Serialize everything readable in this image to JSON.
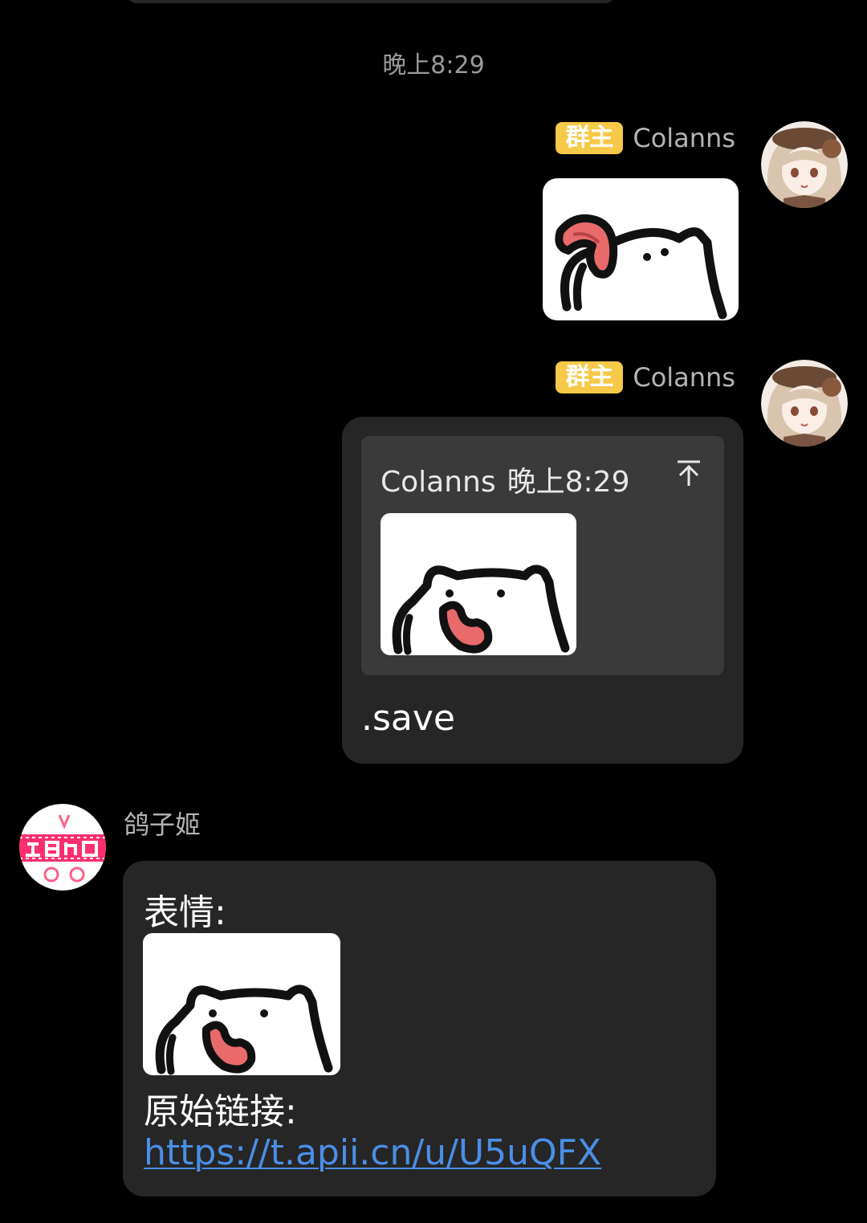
{
  "chat": {
    "timestamp": "晚上8:29",
    "messages": [
      {
        "sender": "Colanns",
        "badge": "群主",
        "side": "right",
        "type": "sticker",
        "sticker_icon": "cat-tongue-sticker"
      },
      {
        "sender": "Colanns",
        "badge": "群主",
        "side": "right",
        "type": "reply",
        "quote": {
          "author": "Colanns",
          "time": "晚上8:29",
          "jump_icon": "jump-to-top-icon",
          "sticker_icon": "cat-open-mouth-sticker"
        },
        "text": ".save"
      },
      {
        "sender": "鸽子姬",
        "side": "left",
        "type": "rich",
        "line1": "表情:",
        "sticker_icon": "cat-open-mouth-sticker",
        "line2": "原始链接:",
        "link": "https://t.apii.cn/u/U5uQFX"
      }
    ]
  },
  "colors": {
    "background": "#000000",
    "bubble": "#262626",
    "quote_background": "#3a3a3a",
    "badge": "#f7c948",
    "link": "#4a8fe8",
    "timestamp": "#9a9a9a"
  }
}
